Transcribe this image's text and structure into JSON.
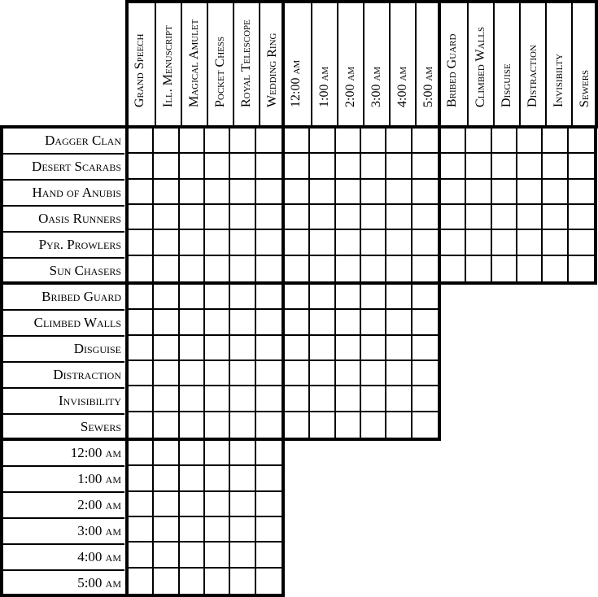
{
  "puzzle": {
    "column_groups": [
      {
        "name": "items",
        "labels": [
          "Grand Speech",
          "Ill. Menuscript",
          "Magical Amulet",
          "Pocket Chess",
          "Royal Telescope",
          "Wedding Ring"
        ]
      },
      {
        "name": "times",
        "labels": [
          "12:00 am",
          "1:00 am",
          "2:00 am",
          "3:00 am",
          "4:00 am",
          "5:00 am"
        ]
      },
      {
        "name": "methods",
        "labels": [
          "Bribed Guard",
          "Climbed Walls",
          "Disguise",
          "Distraction",
          "Invisibilty",
          "Sewers"
        ]
      }
    ],
    "row_groups": [
      {
        "name": "clans",
        "labels": [
          "Dagger Clan",
          "Desert Scarabs",
          "Hand of Anubis",
          "Oasis Runners",
          "Pyr. Prowlers",
          "Sun Chasers"
        ]
      },
      {
        "name": "methods",
        "labels": [
          "Bribed Guard",
          "Climbed Walls",
          "Disguise",
          "Distraction",
          "Invisibility",
          "Sewers"
        ]
      },
      {
        "name": "times",
        "labels": [
          "12:00 am",
          "1:00 am",
          "2:00 am",
          "3:00 am",
          "4:00 am",
          "5:00 am"
        ]
      }
    ],
    "blocks_per_row_group": [
      3,
      2,
      1
    ],
    "cell_marks": "all empty"
  }
}
